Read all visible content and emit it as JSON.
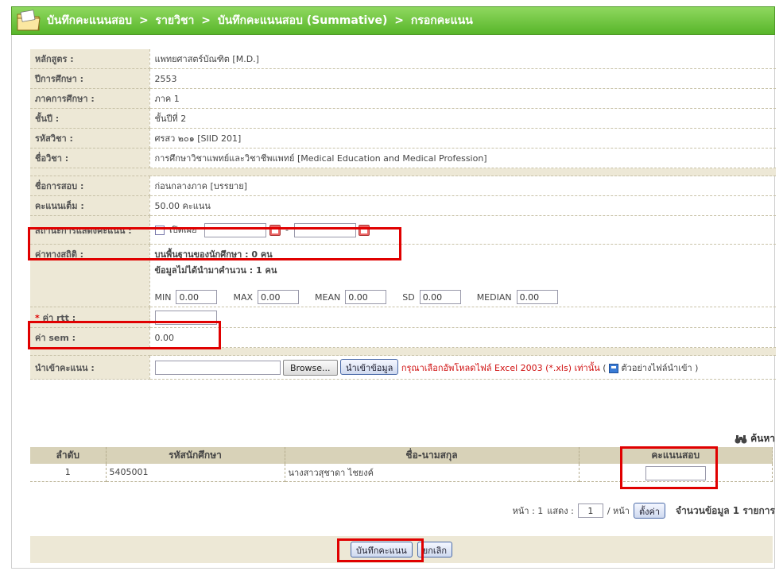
{
  "breadcrumb": {
    "items": [
      "บันทึกคะแนนสอบ",
      "รายวิชา",
      "บันทึกคะแนนสอบ (Summative)",
      "กรอกคะแนน"
    ],
    "separator": ">"
  },
  "info": {
    "course_label": "หลักสูตร :",
    "course_value": "แพทยศาสตร์บัณฑิต [M.D.]",
    "year_label": "ปีการศึกษา :",
    "year_value": "2553",
    "semester_label": "ภาคการศึกษา :",
    "semester_value": "ภาค 1",
    "grade_label": "ชั้นปี :",
    "grade_value": "ชั้นปีที่ 2",
    "subject_code_label": "รหัสวิชา :",
    "subject_code_value": "ศรสว ๒๐๑ [SIID 201]",
    "subject_name_label": "ชื่อวิชา :",
    "subject_name_value": "การศึกษาวิชาแพทย์และวิชาชีพแพทย์ [Medical Education and Medical Profession]",
    "exam_name_label": "ชื่อการสอบ :",
    "exam_name_value": "ก่อนกลางภาค [บรรยาย]",
    "full_score_label": "คะแนนเต็ม :",
    "full_score_value": "50.00 คะแนน",
    "display_status_label": "สถานะการแสดงคะแนน :",
    "publish_label": "เปิดเผย",
    "date_separator": "-",
    "stats_label": "ค่าทางสถิติ :",
    "stats_base": "บนพื้นฐานของนักศึกษา : 0 คน",
    "stats_missing": "ข้อมูลไม่ได้นำมาคำนวน : 1 คน",
    "min_label": "MIN",
    "min_value": "0.00",
    "max_label": "MAX",
    "max_value": "0.00",
    "mean_label": "MEAN",
    "mean_value": "0.00",
    "sd_label": "SD",
    "sd_value": "0.00",
    "median_label": "MEDIAN",
    "median_value": "0.00",
    "rtt_required": "*",
    "rtt_label": "ค่า rtt :",
    "sem_label": "ค่า sem :",
    "sem_value": "0.00",
    "import_label": "นำเข้าคะแนน :",
    "browse_label": "Browse...",
    "import_button": "นำเข้าข้อมูล",
    "import_note": "กรุณาเลือกอัพโหลดไฟล์ Excel 2003 (*.xls) เท่านั้น",
    "sample_open": "(",
    "sample_file": "ตัวอย่างไฟล์นำเข้า",
    "sample_close": ")"
  },
  "search": {
    "label": "ค้นหา"
  },
  "grid": {
    "headers": [
      "ลำดับ",
      "รหัสนักศึกษา",
      "ชื่อ-นามสกุล",
      "คะแนนสอบ"
    ],
    "rows": [
      {
        "no": "1",
        "student_id": "5405001",
        "name": "นางสาวสุชาดา ไชยงค์"
      }
    ]
  },
  "pager": {
    "page_text": "หน้า : 1",
    "show_label": "แสดง :",
    "show_value": "1",
    "per_page": "/ หน้า",
    "set_button": "ตั้งค่า",
    "count_text": "จำนวนข้อมูล 1 รายการ"
  },
  "footer": {
    "save_button": "บันทึกคะแนน",
    "cancel_button": "ยกเลิก"
  },
  "colors": {
    "header_green": "#58b62a",
    "highlight_red": "#e00000",
    "label_bg": "#ede8d6"
  }
}
